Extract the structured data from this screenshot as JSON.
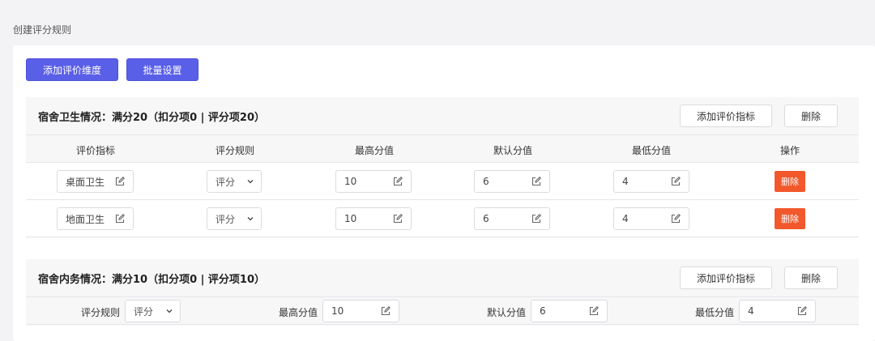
{
  "page": {
    "title": "创建评分规则"
  },
  "toolbar": {
    "add_dimension_label": "添加评价维度",
    "batch_settings_label": "批量设置"
  },
  "colors": {
    "primary": "#5a5fe8",
    "danger": "#f2582b",
    "panel": "#f7f7f8",
    "border": "#dcdcdf"
  },
  "section1": {
    "title": "宿舍卫生情况：满分20（扣分项0 | 评分项20）",
    "add_indicator_label": "添加评价指标",
    "delete_label": "删除",
    "columns": [
      "评价指标",
      "评分规则",
      "最高分值",
      "默认分值",
      "最低分值",
      "操作"
    ],
    "rows": [
      {
        "indicator": "桌面卫生",
        "rule": "评分",
        "max": "10",
        "default": "6",
        "min": "4",
        "action": "删除"
      },
      {
        "indicator": "地面卫生",
        "rule": "评分",
        "max": "10",
        "default": "6",
        "min": "4",
        "action": "删除"
      }
    ]
  },
  "section2": {
    "title": "宿舍内务情况：满分10（扣分项0 | 评分项10）",
    "add_indicator_label": "添加评价指标",
    "delete_label": "删除",
    "rule_label": "评分规则",
    "rule_value": "评分",
    "max_label": "最高分值",
    "max_value": "10",
    "default_label": "默认分值",
    "default_value": "6",
    "min_label": "最低分值",
    "min_value": "4"
  },
  "icons": {
    "edit": "edit-icon",
    "dropdown": "chevron-down-icon"
  }
}
